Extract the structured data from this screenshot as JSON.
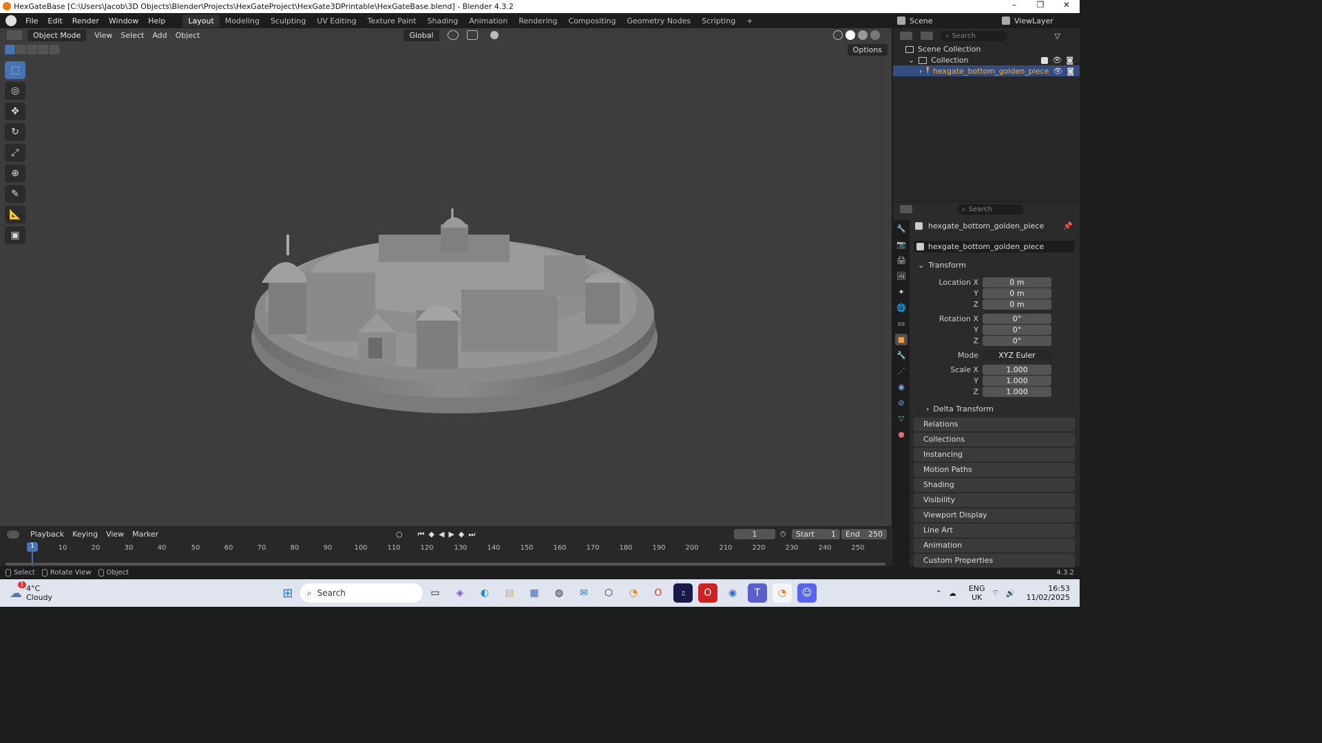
{
  "window": {
    "title": "HexGateBase [C:\\Users\\Jacob\\3D Objects\\Blender\\Projects\\HexGateProject\\HexGate3DPrintable\\HexGateBase.blend] - Blender 4.3.2",
    "controls": [
      "–",
      "❐",
      "✕"
    ]
  },
  "menu": [
    "File",
    "Edit",
    "Render",
    "Window",
    "Help"
  ],
  "workspaces": [
    "Layout",
    "Modeling",
    "Sculpting",
    "UV Editing",
    "Texture Paint",
    "Shading",
    "Animation",
    "Rendering",
    "Compositing",
    "Geometry Nodes",
    "Scripting"
  ],
  "active_workspace": "Layout",
  "scene": {
    "label": "Scene",
    "view_layer": "ViewLayer"
  },
  "viewport": {
    "mode": "Object Mode",
    "menus": [
      "View",
      "Select",
      "Add",
      "Object"
    ],
    "transform_orientation": "Global",
    "options_label": "Options"
  },
  "timeline": {
    "menus": [
      "Playback",
      "Keying",
      "View",
      "Marker"
    ],
    "current_frame": "1",
    "start_label": "Start",
    "start": "1",
    "end_label": "End",
    "end": "250",
    "ticks": [
      "10",
      "20",
      "30",
      "40",
      "50",
      "60",
      "70",
      "80",
      "90",
      "100",
      "110",
      "120",
      "130",
      "140",
      "150",
      "160",
      "170",
      "180",
      "190",
      "200",
      "210",
      "220",
      "230",
      "240",
      "250"
    ],
    "frame_marker": "1"
  },
  "status": {
    "select": "Select",
    "rotate": "Rotate View",
    "object": "Object",
    "version": "4.3.2"
  },
  "outliner": {
    "search_placeholder": "Search",
    "scene_collection": "Scene Collection",
    "collection": "Collection",
    "object": "hexgate_bottom_golden_piece"
  },
  "properties": {
    "search_placeholder": "Search",
    "object_name": "hexgate_bottom_golden_piece",
    "data_name": "hexgate_bottom_golden_piece",
    "transform_label": "Transform",
    "location_x_label": "Location X",
    "location_x": "0 m",
    "location_y_label": "Y",
    "location_y": "0 m",
    "location_z_label": "Z",
    "location_z": "0 m",
    "rotation_x_label": "Rotation X",
    "rotation_x": "0°",
    "rotation_y_label": "Y",
    "rotation_y": "0°",
    "rotation_z_label": "Z",
    "rotation_z": "0°",
    "mode_label": "Mode",
    "mode": "XYZ Euler",
    "scale_x_label": "Scale X",
    "scale_x": "1.000",
    "scale_y_label": "Y",
    "scale_y": "1.000",
    "scale_z_label": "Z",
    "scale_z": "1.000",
    "delta": "Delta Transform",
    "panels": [
      "Relations",
      "Collections",
      "Instancing",
      "Motion Paths",
      "Shading",
      "Visibility",
      "Viewport Display",
      "Line Art",
      "Animation",
      "Custom Properties"
    ]
  },
  "taskbar": {
    "weather_temp": "4°C",
    "weather_text": "Cloudy",
    "weather_badge": "1",
    "search_placeholder": "Search",
    "lang": "ENG",
    "region": "UK",
    "time": "16:53",
    "date": "11/02/2025"
  }
}
